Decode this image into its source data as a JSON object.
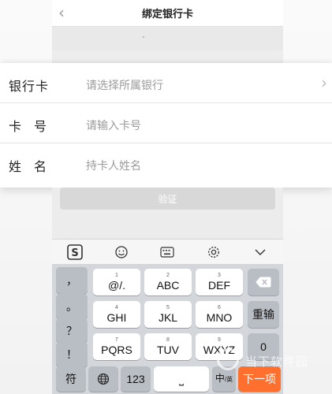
{
  "nav": {
    "back_icon": "chevron-left-icon",
    "title": "绑定银行卡"
  },
  "form": {
    "bank": {
      "label": "银行卡",
      "placeholder": "请选择所属银行"
    },
    "card_number": {
      "label": "卡号",
      "placeholder": "请输入卡号"
    },
    "name": {
      "label": "姓名",
      "placeholder": "持卡人姓名"
    }
  },
  "verify_button": {
    "label": "验证"
  },
  "keyboard": {
    "toolbar_icons": [
      "sogou-logo-icon",
      "emoji-icon",
      "keyboard-icon",
      "settings-icon",
      "collapse-icon"
    ],
    "toolbar_logo_text": "S",
    "left_column": [
      "，",
      "。",
      "？",
      "！"
    ],
    "keys": [
      {
        "num": "1",
        "label": "@/."
      },
      {
        "num": "2",
        "label": "ABC"
      },
      {
        "num": "3",
        "label": "DEF"
      },
      {
        "num": "4",
        "label": "GHI"
      },
      {
        "num": "5",
        "label": "JKL"
      },
      {
        "num": "6",
        "label": "MNO"
      },
      {
        "num": "7",
        "label": "PQRS"
      },
      {
        "num": "8",
        "label": "TUV"
      },
      {
        "num": "9",
        "label": "WXYZ"
      }
    ],
    "retype_label": "重输",
    "zero_label": "0",
    "symbol_label": "符",
    "num_label": "123",
    "space_label": "⎵",
    "lang_label": "中",
    "lang_sub": "/英",
    "next_label": "下一项"
  },
  "watermark": {
    "text": "当下软件园"
  }
}
